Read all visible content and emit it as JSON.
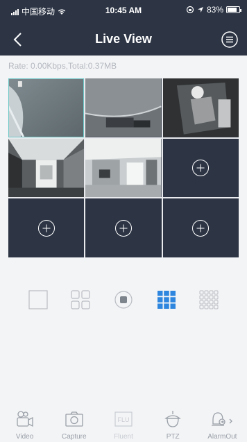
{
  "status_bar": {
    "carrier": "中国移动",
    "time": "10:45 AM",
    "battery": "83%",
    "battery_level": 0.83
  },
  "nav": {
    "title": "Live View",
    "back_icon": "chevron-left-icon",
    "menu_icon": "menu-circle-icon"
  },
  "rate_text": "Rate: 0.00Kbps,Total:0.37MB",
  "cells": [
    {
      "kind": "feed",
      "selected": true
    },
    {
      "kind": "feed",
      "selected": false
    },
    {
      "kind": "feed",
      "selected": false
    },
    {
      "kind": "feed",
      "selected": false
    },
    {
      "kind": "feed",
      "selected": false
    },
    {
      "kind": "empty",
      "icon": "add-circle-icon"
    },
    {
      "kind": "empty",
      "icon": "add-circle-icon"
    },
    {
      "kind": "empty",
      "icon": "add-circle-icon"
    },
    {
      "kind": "empty",
      "icon": "add-circle-icon"
    }
  ],
  "layout_options": [
    {
      "name": "layout-1x1-icon",
      "active": false
    },
    {
      "name": "layout-2x2-icon",
      "active": false
    },
    {
      "name": "stop-all-icon",
      "active": false
    },
    {
      "name": "layout-3x3-icon",
      "active": true
    },
    {
      "name": "layout-4x4-icon",
      "active": false
    }
  ],
  "toolbar": {
    "video": "Video",
    "capture": "Capture",
    "fluent": "Fluent",
    "fluent_icon_text": "FLU",
    "ptz": "PTZ",
    "alarm_out": "AlarmOut"
  },
  "colors": {
    "nav_bg": "#2d3545",
    "accent": "#2e86de",
    "selected_border": "#6ec8c8"
  }
}
